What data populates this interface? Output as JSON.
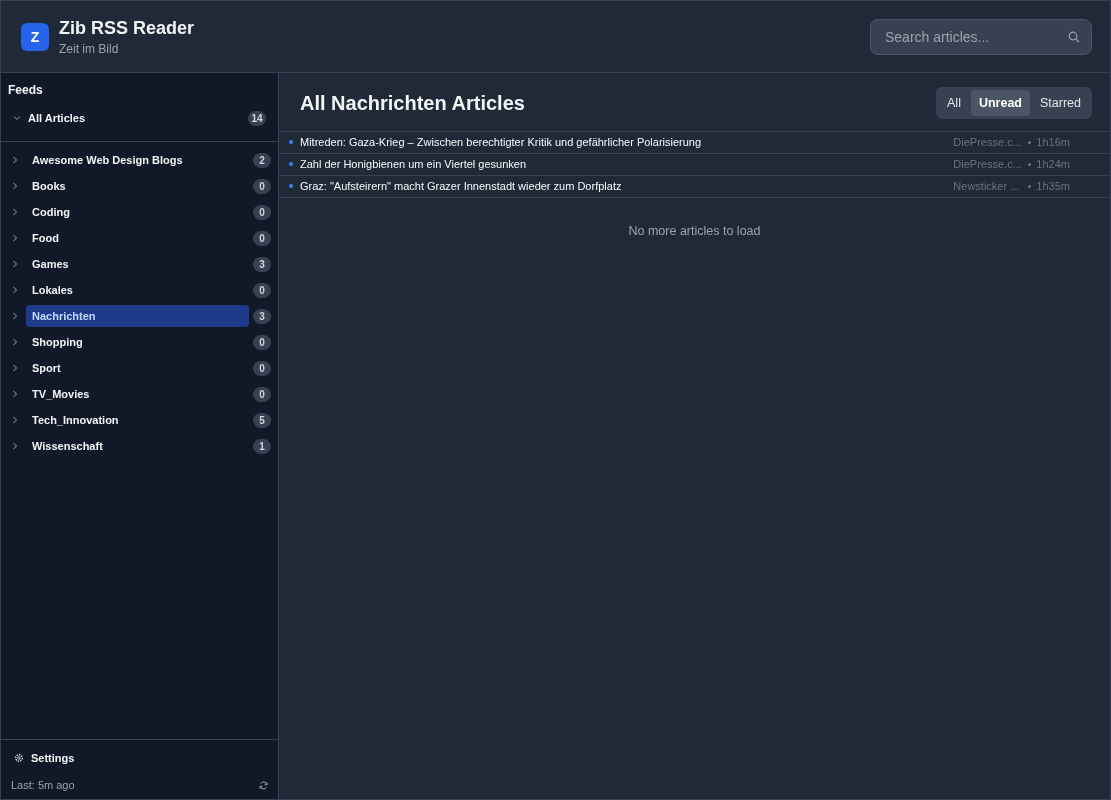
{
  "header": {
    "logo_letter": "Z",
    "title": "Zib RSS Reader",
    "subtitle": "Zeit im Bild",
    "search": {
      "placeholder": "Search articles..."
    }
  },
  "sidebar": {
    "heading": "Feeds",
    "all_articles": {
      "label": "All Articles",
      "count": "14",
      "expanded": true
    },
    "feeds": [
      {
        "label": "Awesome Web Design Blogs",
        "count": "2",
        "selected": false
      },
      {
        "label": "Books",
        "count": "0",
        "selected": false
      },
      {
        "label": "Coding",
        "count": "0",
        "selected": false
      },
      {
        "label": "Food",
        "count": "0",
        "selected": false
      },
      {
        "label": "Games",
        "count": "3",
        "selected": false
      },
      {
        "label": "Lokales",
        "count": "0",
        "selected": false
      },
      {
        "label": "Nachrichten",
        "count": "3",
        "selected": true
      },
      {
        "label": "Shopping",
        "count": "0",
        "selected": false
      },
      {
        "label": "Sport",
        "count": "0",
        "selected": false
      },
      {
        "label": "TV_Movies",
        "count": "0",
        "selected": false
      },
      {
        "label": "Tech_Innovation",
        "count": "5",
        "selected": false
      },
      {
        "label": "Wissenschaft",
        "count": "1",
        "selected": false
      }
    ],
    "settings": "Settings",
    "last_update": "Last: 5m ago"
  },
  "main": {
    "title": "All Nachrichten Articles",
    "filters": [
      {
        "label": "All",
        "selected": false
      },
      {
        "label": "Unread",
        "selected": true
      },
      {
        "label": "Starred",
        "selected": false
      }
    ],
    "articles": [
      {
        "title": "Mitreden: Gaza-Krieg – Zwischen berechtigter Kritik und gefährlicher Polarisierung",
        "source": "DiePresse.c...",
        "time": "1h16m",
        "unread": true
      },
      {
        "title": "Zahl der Honigbienen um ein Viertel gesunken",
        "source": "DiePresse.c...",
        "time": "1h24m",
        "unread": true
      },
      {
        "title": "Graz: \"Aufsteirern\" macht Grazer Innenstadt wieder zum Dorfplatz",
        "source": "Newsticker ...",
        "time": "1h35m",
        "unread": true
      }
    ],
    "end_message": "No more articles to load"
  }
}
